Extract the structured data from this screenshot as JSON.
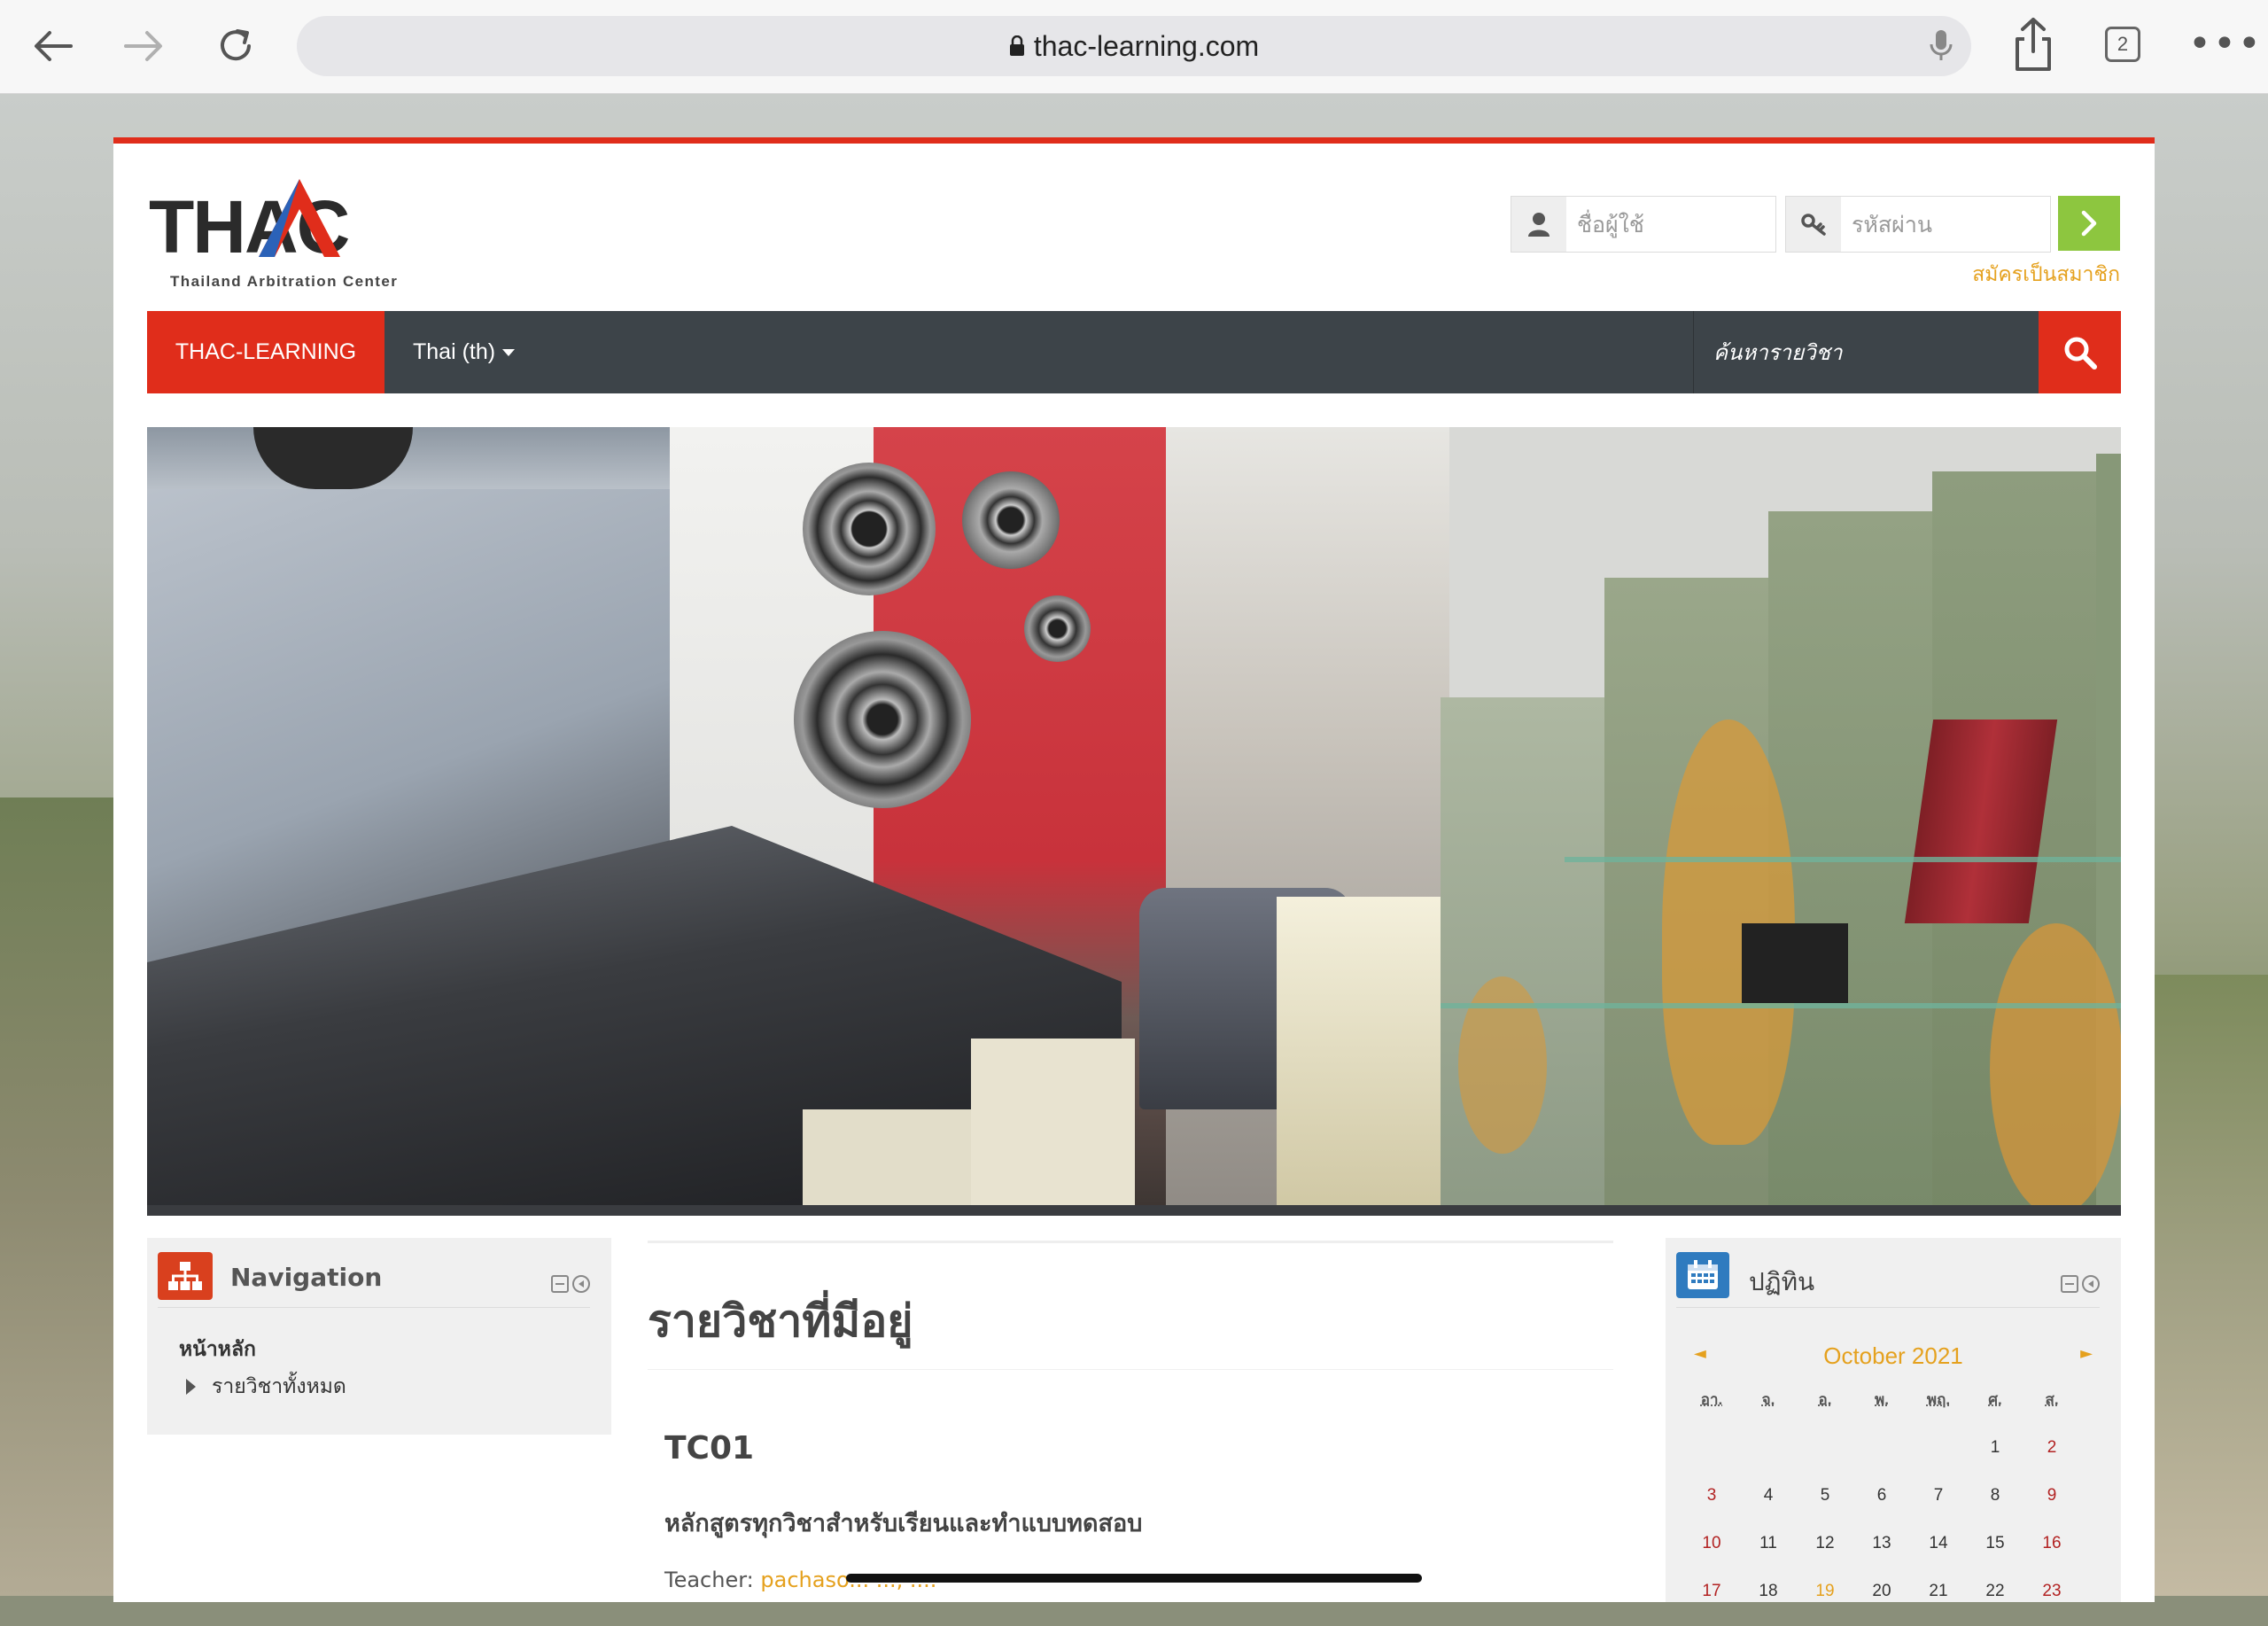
{
  "browser": {
    "url": "thac-learning.com",
    "tab_count": "2",
    "more": "•••"
  },
  "header": {
    "logo_text": "THAC",
    "logo_subtitle": "Thailand Arbitration Center",
    "username_placeholder": "ชื่อผู้ใช้",
    "password_placeholder": "รหัสผ่าน",
    "signup_label": "สมัครเป็นสมาชิก"
  },
  "navbar": {
    "brand": "THAC-LEARNING",
    "language": "Thai (th)",
    "search_placeholder": "ค้นหารายวิชา"
  },
  "navigation_block": {
    "title": "Navigation",
    "home": "หน้าหลัก",
    "all_courses": "รายวิชาทั้งหมด"
  },
  "main": {
    "heading": "รายวิชาที่มีอยู่",
    "course": {
      "code": "TC01",
      "summary": "หลักสูตรทุกวิชาสำหรับเรียนและทำแบบทดสอบ",
      "teacher_label": "Teacher:",
      "teacher_name": "pachaso... ..., ...."
    }
  },
  "calendar_block": {
    "title": "ปฏิทิน",
    "month": "October 2021",
    "prev": "◄",
    "next": "►",
    "weekdays": [
      "อา.",
      "จ.",
      "อ.",
      "พ.",
      "พฤ.",
      "ศ.",
      "ส."
    ],
    "weeks": [
      [
        "",
        "",
        "",
        "",
        "",
        "1",
        "2"
      ],
      [
        "3",
        "4",
        "5",
        "6",
        "7",
        "8",
        "9"
      ],
      [
        "10",
        "11",
        "12",
        "13",
        "14",
        "15",
        "16"
      ],
      [
        "17",
        "18",
        "19",
        "20",
        "21",
        "22",
        "23"
      ]
    ],
    "today": "19"
  },
  "colors": {
    "brand_red": "#e02d1b",
    "navbar_dark": "#3d4449",
    "accent_orange": "#e5a11e",
    "login_green": "#8dc63f",
    "nav_icon_bg": "#d9401e",
    "cal_icon_bg": "#2f7bbf"
  }
}
